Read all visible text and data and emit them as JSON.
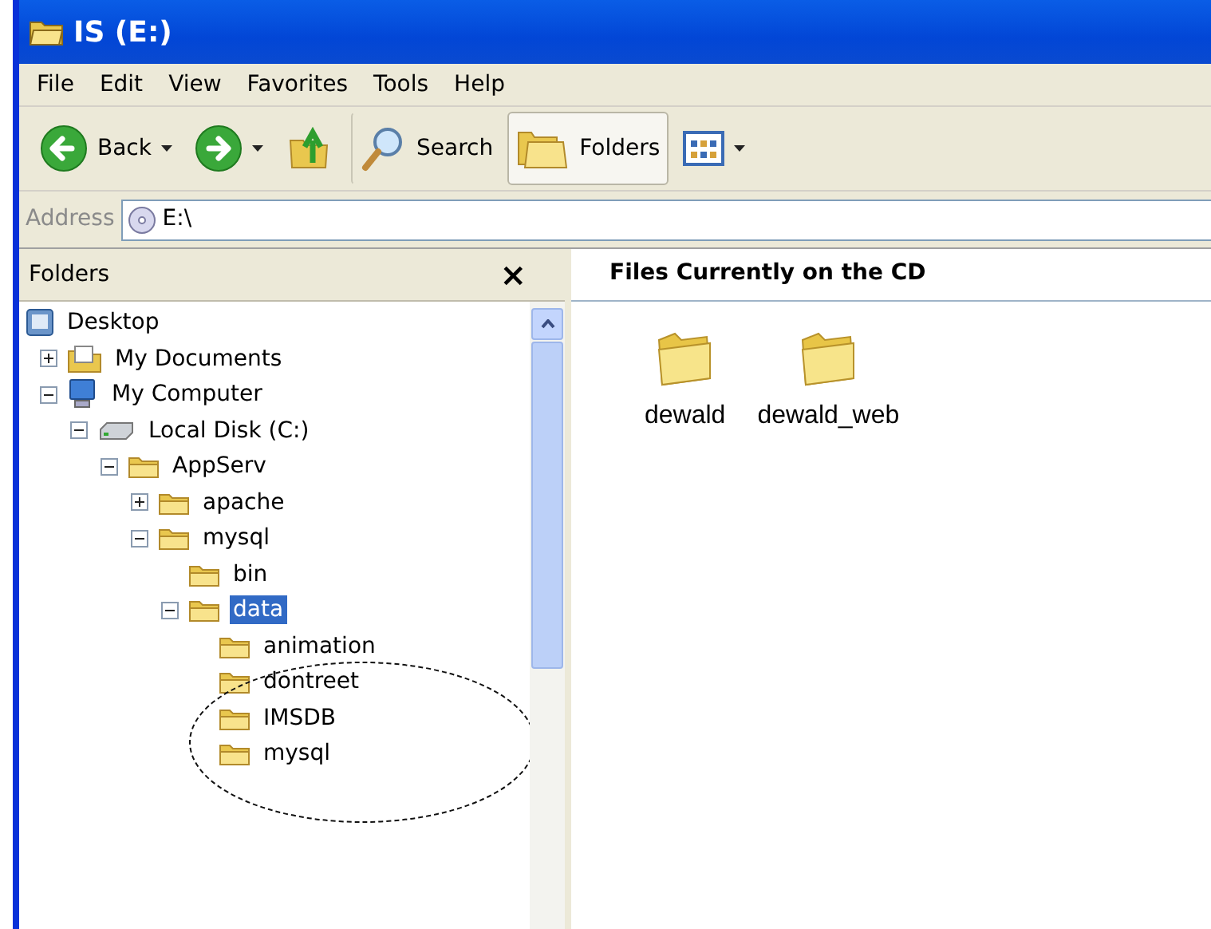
{
  "window": {
    "title": "IS (E:)"
  },
  "menu": [
    "File",
    "Edit",
    "View",
    "Favorites",
    "Tools",
    "Help"
  ],
  "toolbar": [
    {
      "kind": "back",
      "label": "Back",
      "selected": false
    },
    {
      "kind": "forward",
      "selected": false
    },
    {
      "kind": "up",
      "selected": false
    },
    {
      "kind": "search",
      "label": "Search",
      "selected": false
    },
    {
      "kind": "folders",
      "label": "Folders",
      "selected": true
    },
    {
      "kind": "views",
      "selected": false
    }
  ],
  "address": {
    "label": "Address",
    "value": "E:\\"
  },
  "folders_pane": {
    "title": "Folders",
    "close": "×",
    "tree": [
      {
        "label": "Desktop",
        "kind": "desktop",
        "selected": false,
        "children": [
          {
            "label": "My Documents",
            "kind": "documents",
            "expanded": false,
            "selected": false
          },
          {
            "label": "My Computer",
            "kind": "computer",
            "expanded": true,
            "selected": false,
            "children": [
              {
                "label": "Local Disk (C:)",
                "kind": "drive",
                "expanded": true,
                "selected": false,
                "children": [
                  {
                    "label": "AppServ",
                    "kind": "folder",
                    "expanded": true,
                    "selected": false,
                    "children": [
                      {
                        "label": "apache",
                        "kind": "folder",
                        "expanded": false,
                        "selected": false
                      },
                      {
                        "label": "mysql",
                        "kind": "folder",
                        "expanded": true,
                        "selected": false,
                        "children": [
                          {
                            "label": "bin",
                            "kind": "folder",
                            "selected": false
                          },
                          {
                            "label": "data",
                            "kind": "folder",
                            "expanded": true,
                            "selected": true,
                            "children": [
                              {
                                "label": "animation",
                                "kind": "folder",
                                "selected": false
                              },
                              {
                                "label": "dontreet",
                                "kind": "folder",
                                "selected": false
                              },
                              {
                                "label": "IMSDB",
                                "kind": "folder",
                                "selected": false
                              },
                              {
                                "label": "mysql",
                                "kind": "folder",
                                "selected": false
                              }
                            ]
                          }
                        ]
                      }
                    ]
                  }
                ]
              }
            ]
          }
        ]
      }
    ]
  },
  "content": {
    "heading": "Files Currently on the CD",
    "items": [
      {
        "label": "dewald"
      },
      {
        "label": "dewald_web"
      }
    ]
  }
}
